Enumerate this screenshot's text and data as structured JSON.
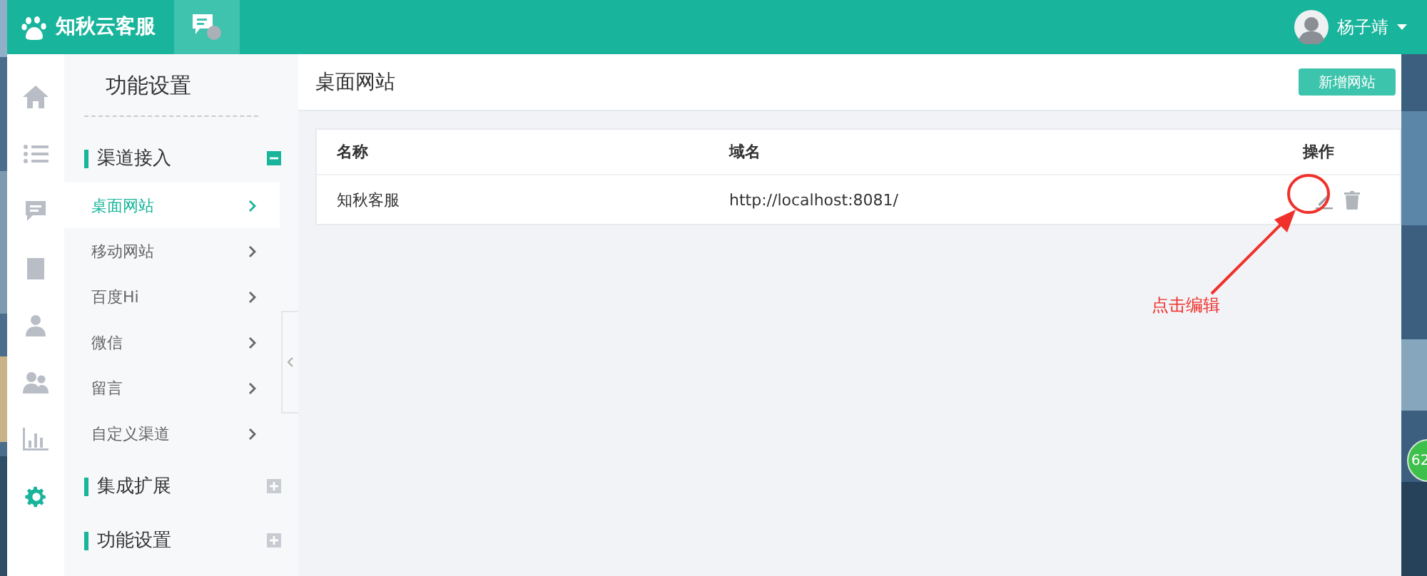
{
  "app": {
    "title": "知秋云客服"
  },
  "user": {
    "name": "杨子靖"
  },
  "rail": [
    {
      "selected": false
    },
    {
      "selected": false
    },
    {
      "selected": false
    },
    {
      "selected": false
    },
    {
      "selected": false
    },
    {
      "selected": false
    },
    {
      "selected": false
    },
    {
      "selected": true
    }
  ],
  "menu": {
    "title": "功能设置",
    "groups": [
      {
        "label": "渠道接入",
        "expanded": true,
        "children": [
          {
            "label": "桌面网站",
            "selected": true
          },
          {
            "label": "移动网站",
            "selected": false
          },
          {
            "label": "百度Hi",
            "selected": false
          },
          {
            "label": "微信",
            "selected": false
          },
          {
            "label": "留言",
            "selected": false
          },
          {
            "label": "自定义渠道",
            "selected": false
          }
        ]
      },
      {
        "label": "集成扩展",
        "expanded": false
      },
      {
        "label": "功能设置",
        "expanded": false
      }
    ]
  },
  "page": {
    "title": "桌面网站",
    "add_button": "新增网站"
  },
  "table": {
    "columns": [
      "名称",
      "域名",
      "操作"
    ],
    "rows": [
      {
        "name": "知秋客服",
        "domain": "http://localhost:8081/"
      }
    ]
  },
  "annotation": {
    "text": "点击编辑"
  },
  "desktop_badge": {
    "text": "62"
  }
}
